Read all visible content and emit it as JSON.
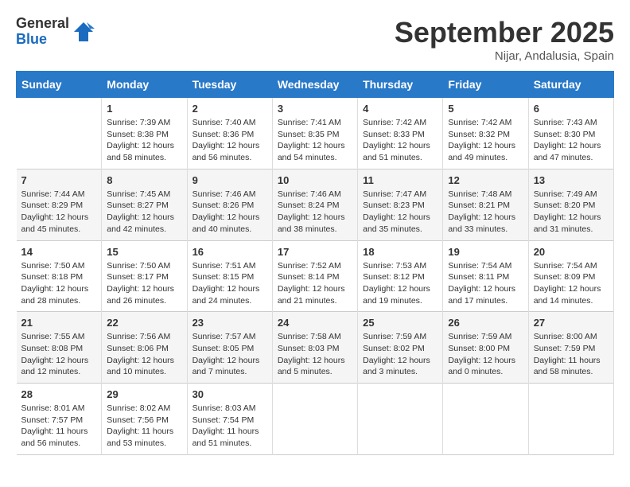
{
  "logo": {
    "general": "General",
    "blue": "Blue"
  },
  "title": "September 2025",
  "subtitle": "Nijar, Andalusia, Spain",
  "days_of_week": [
    "Sunday",
    "Monday",
    "Tuesday",
    "Wednesday",
    "Thursday",
    "Friday",
    "Saturday"
  ],
  "weeks": [
    [
      {
        "day": "",
        "info": ""
      },
      {
        "day": "1",
        "info": "Sunrise: 7:39 AM\nSunset: 8:38 PM\nDaylight: 12 hours\nand 58 minutes."
      },
      {
        "day": "2",
        "info": "Sunrise: 7:40 AM\nSunset: 8:36 PM\nDaylight: 12 hours\nand 56 minutes."
      },
      {
        "day": "3",
        "info": "Sunrise: 7:41 AM\nSunset: 8:35 PM\nDaylight: 12 hours\nand 54 minutes."
      },
      {
        "day": "4",
        "info": "Sunrise: 7:42 AM\nSunset: 8:33 PM\nDaylight: 12 hours\nand 51 minutes."
      },
      {
        "day": "5",
        "info": "Sunrise: 7:42 AM\nSunset: 8:32 PM\nDaylight: 12 hours\nand 49 minutes."
      },
      {
        "day": "6",
        "info": "Sunrise: 7:43 AM\nSunset: 8:30 PM\nDaylight: 12 hours\nand 47 minutes."
      }
    ],
    [
      {
        "day": "7",
        "info": "Sunrise: 7:44 AM\nSunset: 8:29 PM\nDaylight: 12 hours\nand 45 minutes."
      },
      {
        "day": "8",
        "info": "Sunrise: 7:45 AM\nSunset: 8:27 PM\nDaylight: 12 hours\nand 42 minutes."
      },
      {
        "day": "9",
        "info": "Sunrise: 7:46 AM\nSunset: 8:26 PM\nDaylight: 12 hours\nand 40 minutes."
      },
      {
        "day": "10",
        "info": "Sunrise: 7:46 AM\nSunset: 8:24 PM\nDaylight: 12 hours\nand 38 minutes."
      },
      {
        "day": "11",
        "info": "Sunrise: 7:47 AM\nSunset: 8:23 PM\nDaylight: 12 hours\nand 35 minutes."
      },
      {
        "day": "12",
        "info": "Sunrise: 7:48 AM\nSunset: 8:21 PM\nDaylight: 12 hours\nand 33 minutes."
      },
      {
        "day": "13",
        "info": "Sunrise: 7:49 AM\nSunset: 8:20 PM\nDaylight: 12 hours\nand 31 minutes."
      }
    ],
    [
      {
        "day": "14",
        "info": "Sunrise: 7:50 AM\nSunset: 8:18 PM\nDaylight: 12 hours\nand 28 minutes."
      },
      {
        "day": "15",
        "info": "Sunrise: 7:50 AM\nSunset: 8:17 PM\nDaylight: 12 hours\nand 26 minutes."
      },
      {
        "day": "16",
        "info": "Sunrise: 7:51 AM\nSunset: 8:15 PM\nDaylight: 12 hours\nand 24 minutes."
      },
      {
        "day": "17",
        "info": "Sunrise: 7:52 AM\nSunset: 8:14 PM\nDaylight: 12 hours\nand 21 minutes."
      },
      {
        "day": "18",
        "info": "Sunrise: 7:53 AM\nSunset: 8:12 PM\nDaylight: 12 hours\nand 19 minutes."
      },
      {
        "day": "19",
        "info": "Sunrise: 7:54 AM\nSunset: 8:11 PM\nDaylight: 12 hours\nand 17 minutes."
      },
      {
        "day": "20",
        "info": "Sunrise: 7:54 AM\nSunset: 8:09 PM\nDaylight: 12 hours\nand 14 minutes."
      }
    ],
    [
      {
        "day": "21",
        "info": "Sunrise: 7:55 AM\nSunset: 8:08 PM\nDaylight: 12 hours\nand 12 minutes."
      },
      {
        "day": "22",
        "info": "Sunrise: 7:56 AM\nSunset: 8:06 PM\nDaylight: 12 hours\nand 10 minutes."
      },
      {
        "day": "23",
        "info": "Sunrise: 7:57 AM\nSunset: 8:05 PM\nDaylight: 12 hours\nand 7 minutes."
      },
      {
        "day": "24",
        "info": "Sunrise: 7:58 AM\nSunset: 8:03 PM\nDaylight: 12 hours\nand 5 minutes."
      },
      {
        "day": "25",
        "info": "Sunrise: 7:59 AM\nSunset: 8:02 PM\nDaylight: 12 hours\nand 3 minutes."
      },
      {
        "day": "26",
        "info": "Sunrise: 7:59 AM\nSunset: 8:00 PM\nDaylight: 12 hours\nand 0 minutes."
      },
      {
        "day": "27",
        "info": "Sunrise: 8:00 AM\nSunset: 7:59 PM\nDaylight: 11 hours\nand 58 minutes."
      }
    ],
    [
      {
        "day": "28",
        "info": "Sunrise: 8:01 AM\nSunset: 7:57 PM\nDaylight: 11 hours\nand 56 minutes."
      },
      {
        "day": "29",
        "info": "Sunrise: 8:02 AM\nSunset: 7:56 PM\nDaylight: 11 hours\nand 53 minutes."
      },
      {
        "day": "30",
        "info": "Sunrise: 8:03 AM\nSunset: 7:54 PM\nDaylight: 11 hours\nand 51 minutes."
      },
      {
        "day": "",
        "info": ""
      },
      {
        "day": "",
        "info": ""
      },
      {
        "day": "",
        "info": ""
      },
      {
        "day": "",
        "info": ""
      }
    ]
  ]
}
